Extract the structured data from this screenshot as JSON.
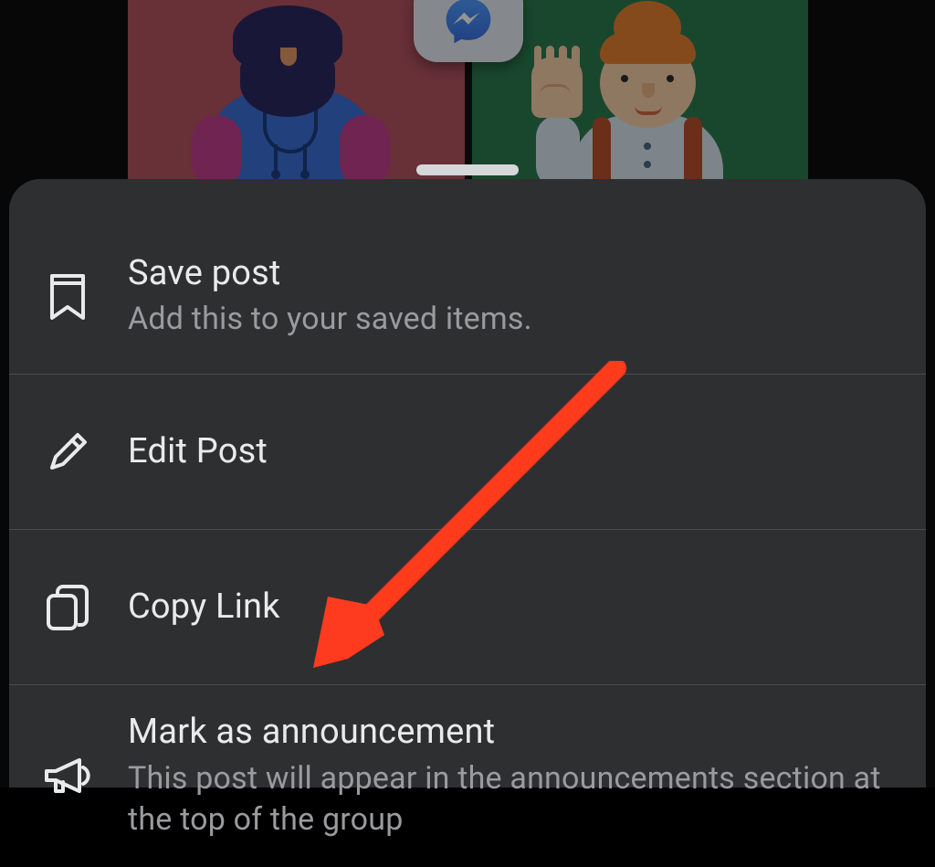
{
  "menu": {
    "items": [
      {
        "title": "Save post",
        "subtitle": "Add this to your saved items."
      },
      {
        "title": "Edit Post",
        "subtitle": ""
      },
      {
        "title": "Copy Link",
        "subtitle": ""
      },
      {
        "title": "Mark as announcement",
        "subtitle": "This post will appear in the announcements section at the top of the group"
      }
    ]
  }
}
